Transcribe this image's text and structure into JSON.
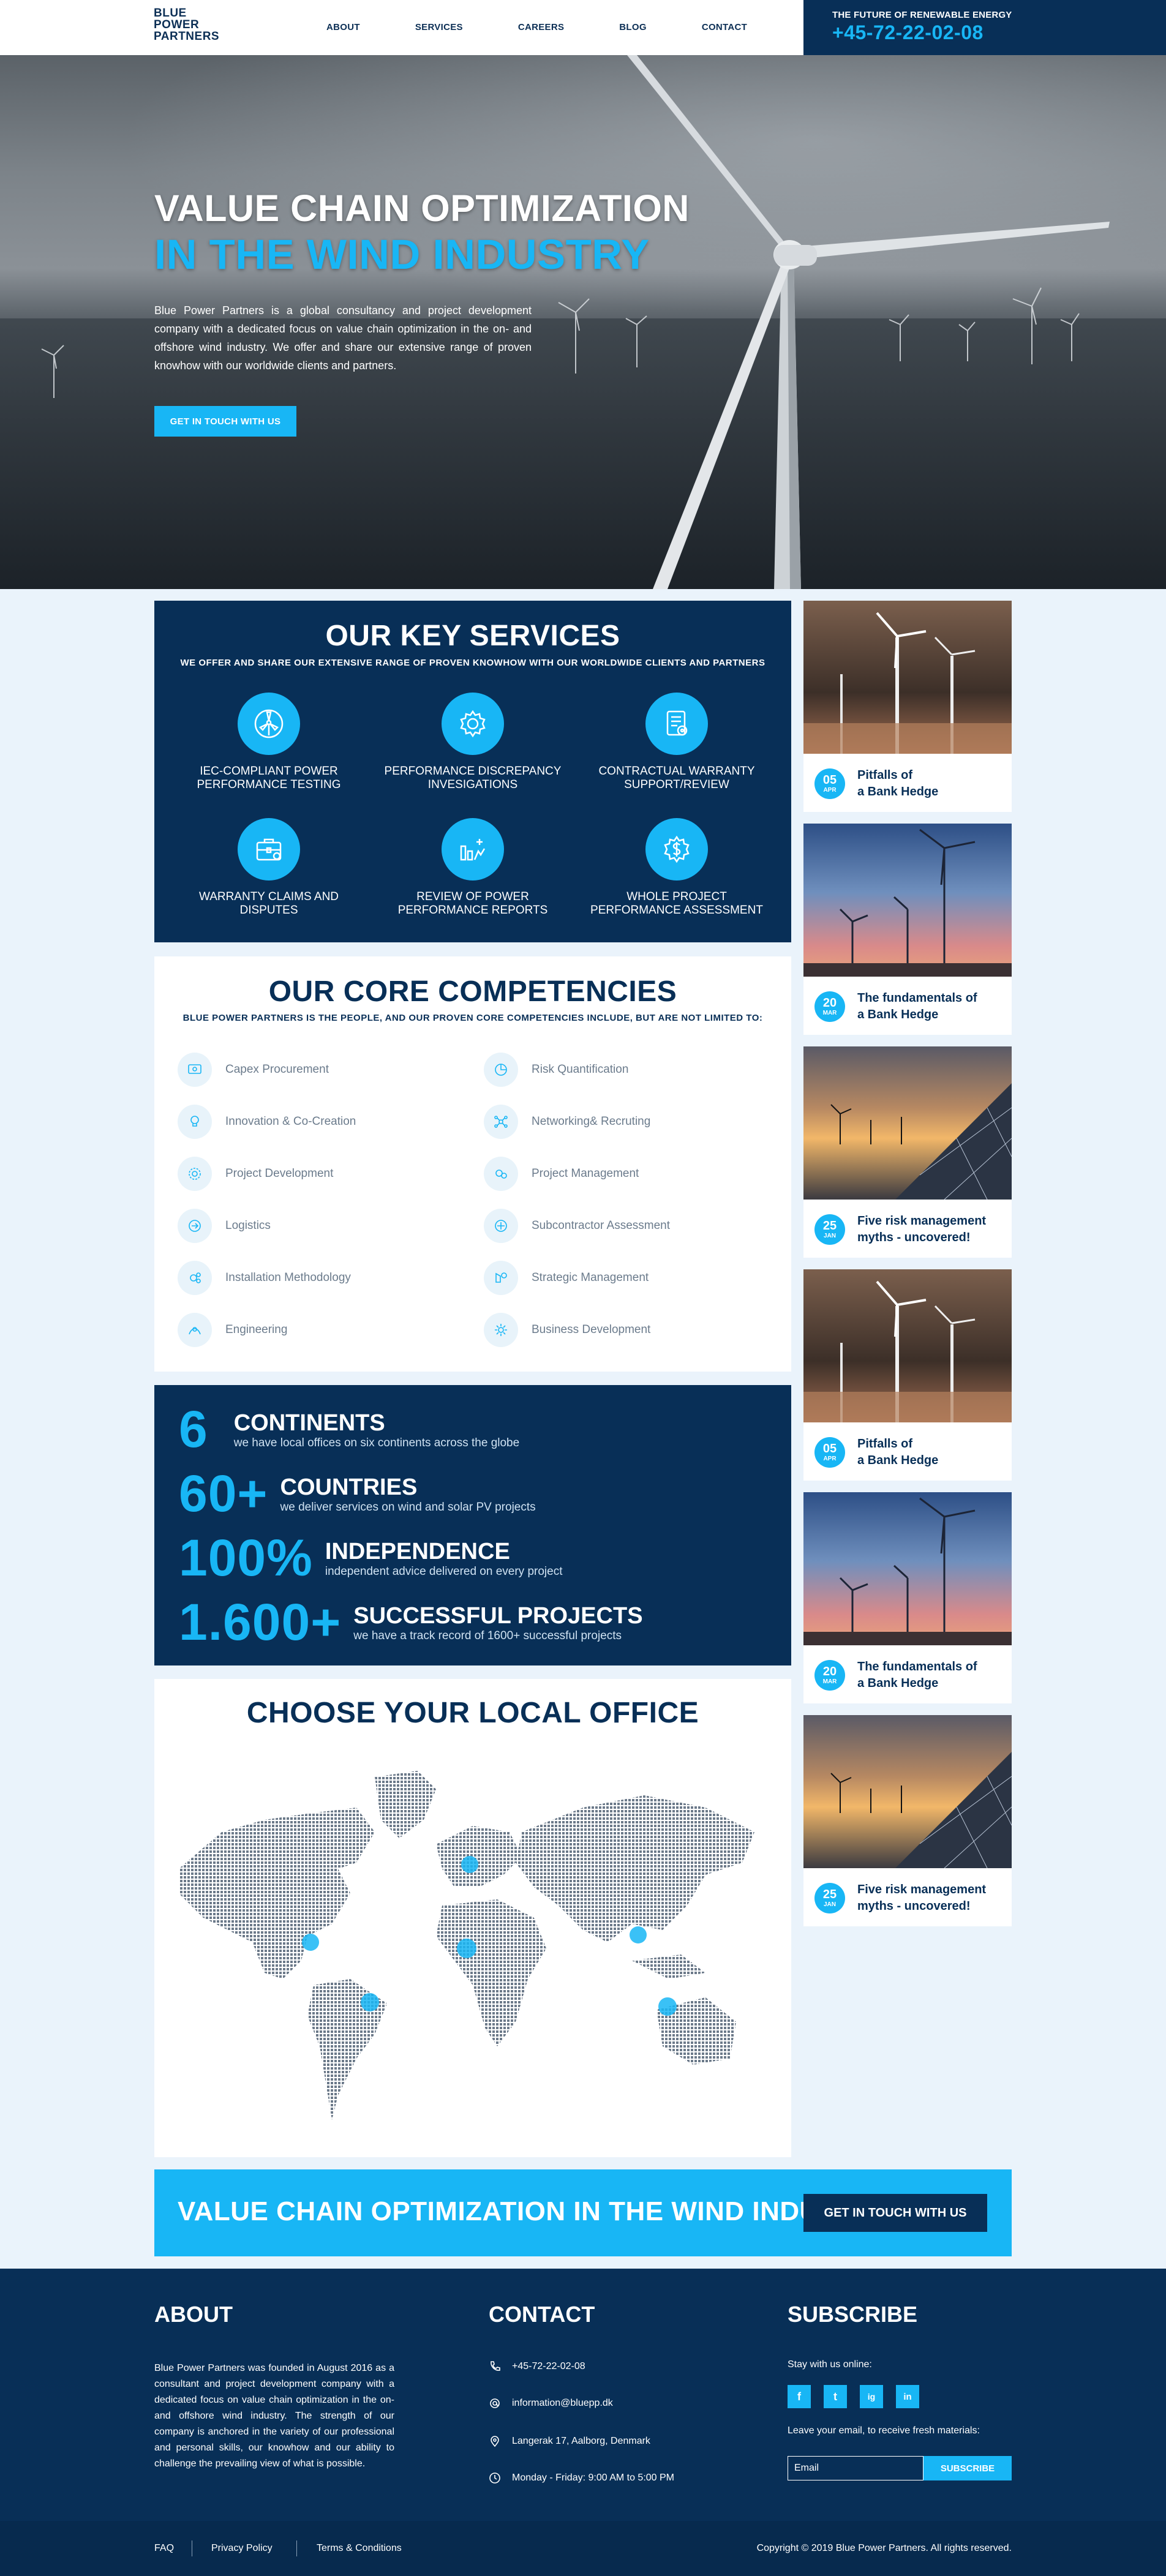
{
  "header": {
    "logo_lines": [
      "Blue",
      "Power",
      "Partners"
    ],
    "nav": [
      "ABOUT",
      "SERVICES",
      "CAREERS",
      "BLOG",
      "CONTACT"
    ],
    "tagline": "THE FUTURE OF RENEWABLE ENERGY",
    "phone": "+45-72-22-02-08"
  },
  "hero": {
    "title_line1": "VALUE CHAIN OPTIMIZATION",
    "title_line2": "IN THE WIND INDUSTRY",
    "text": "Blue Power Partners is a global consultancy and project development company with a dedicated focus on value chain optimization in the on- and offshore wind industry. We offer and share our extensive range of proven knowhow with our worldwide clients and partners.",
    "button": "GET IN TOUCH WITH US"
  },
  "services": {
    "title": "OUR KEY SERVICES",
    "subtitle": "WE OFFER AND SHARE OUR EXTENSIVE RANGE OF PROVEN KNOWHOW WITH OUR WORLDWIDE CLIENTS AND PARTNERS",
    "items": [
      {
        "line1": "IEC-COMPLIANT POWER",
        "line2": "PERFORMANCE TESTING",
        "icon": "turbine-icon"
      },
      {
        "line1": "PERFORMANCE DISCREPANCY",
        "line2": "INVESIGATIONS",
        "icon": "gear-icon"
      },
      {
        "line1": "CONTRACTUAL WARRANTY",
        "line2": "SUPPORT/REVIEW",
        "icon": "document-icon"
      },
      {
        "line1": "WARRANTY CLAIMS AND",
        "line2": "DISPUTES",
        "icon": "briefcase-icon"
      },
      {
        "line1": "REVIEW OF POWER",
        "line2": "PERFORMANCE REPORTS",
        "icon": "chart-icon"
      },
      {
        "line1": "WHOLE PROJECT",
        "line2": "PERFORMANCE ASSESSMENT",
        "icon": "dollar-gear-icon"
      }
    ]
  },
  "competencies": {
    "title": "OUR CORE COMPETENCIES",
    "subtitle": "BLUE POWER PARTNERS IS THE PEOPLE, AND OUR PROVEN CORE COMPETENCIES INCLUDE, BUT ARE NOT LIMITED TO:",
    "left": [
      "Capex Procurement",
      "Innovation & Co-Creation",
      "Project Development",
      "Logistics",
      "Installation Methodology",
      "Engineering"
    ],
    "right": [
      "Risk Quantification",
      "Networking& Recruting",
      "Project Management",
      "Subcontractor Assessment",
      "Strategic Management",
      "Business Development"
    ]
  },
  "stats": [
    {
      "number": "6",
      "title": "CONTINENTS",
      "text": "we have local offices on six continents across the globe"
    },
    {
      "number": "60+",
      "title": "COUNTRIES",
      "text": "we deliver services on wind and solar PV projects"
    },
    {
      "number": "100%",
      "title": "INDEPENDENCE",
      "text": "independent advice delivered on every project"
    },
    {
      "number": "1.600+",
      "title": "SUCCESSFUL PROJECTS",
      "text": "we have a track record of 1600+ successful projects"
    }
  ],
  "map": {
    "title": "CHOOSE YOUR LOCAL OFFICE"
  },
  "posts": [
    {
      "day": "05",
      "month": "APR",
      "title1": "Pitfalls of",
      "title2": "a Bank Hedge",
      "image": "model-turbines"
    },
    {
      "day": "20",
      "month": "MAR",
      "title1": "The fundamentals of",
      "title2": "a Bank Hedge",
      "image": "sunset-turbines"
    },
    {
      "day": "25",
      "month": "JAN",
      "title1": "Five risk management",
      "title2": "myths - uncovered!",
      "image": "solar-turbines"
    },
    {
      "day": "05",
      "month": "APR",
      "title1": "Pitfalls of",
      "title2": "a Bank Hedge",
      "image": "model-turbines"
    },
    {
      "day": "20",
      "month": "MAR",
      "title1": "The fundamentals of",
      "title2": "a Bank Hedge",
      "image": "sunset-turbines"
    },
    {
      "day": "25",
      "month": "JAN",
      "title1": "Five risk management",
      "title2": "myths - uncovered!",
      "image": "solar-turbines"
    }
  ],
  "cta": {
    "text": "VALUE CHAIN OPTIMIZATION IN THE WIND INDUSTRY",
    "button": "GET IN TOUCH WITH US"
  },
  "footer": {
    "about_title": "ABOUT",
    "about_text": "Blue Power Partners was founded in August 2016 as a consultant and project development company with a dedicated focus on value chain optimization in the on- and offshore wind industry. The strength of our company is anchored in the variety of our professional and personal skills, our knowhow and our ability to challenge the prevailing view of what is possible.",
    "contact_title": "CONTACT",
    "phone": "+45-72-22-02-08",
    "email": "information@bluepp.dk",
    "address": "Langerak 17, Aalborg, Denmark",
    "hours": "Monday - Friday: 9:00 AM to 5:00 PM",
    "subscribe_title": "SUBSCRIBE",
    "stay": "Stay with us online:",
    "socials": [
      "f",
      "t",
      "ig",
      "in"
    ],
    "leave": "Leave your email, to receive fresh materials:",
    "email_placeholder": "Email",
    "subscribe_button": "SUBSCRIBE",
    "links": [
      "FAQ",
      "Privacy Policy",
      "Terms & Conditions"
    ],
    "copyright": "Copyright © 2019 Blue Power Partners. All rights reserved."
  },
  "colors": {
    "navy": "#082f57",
    "accent": "#18b6f5",
    "background": "#eaf3fb"
  }
}
